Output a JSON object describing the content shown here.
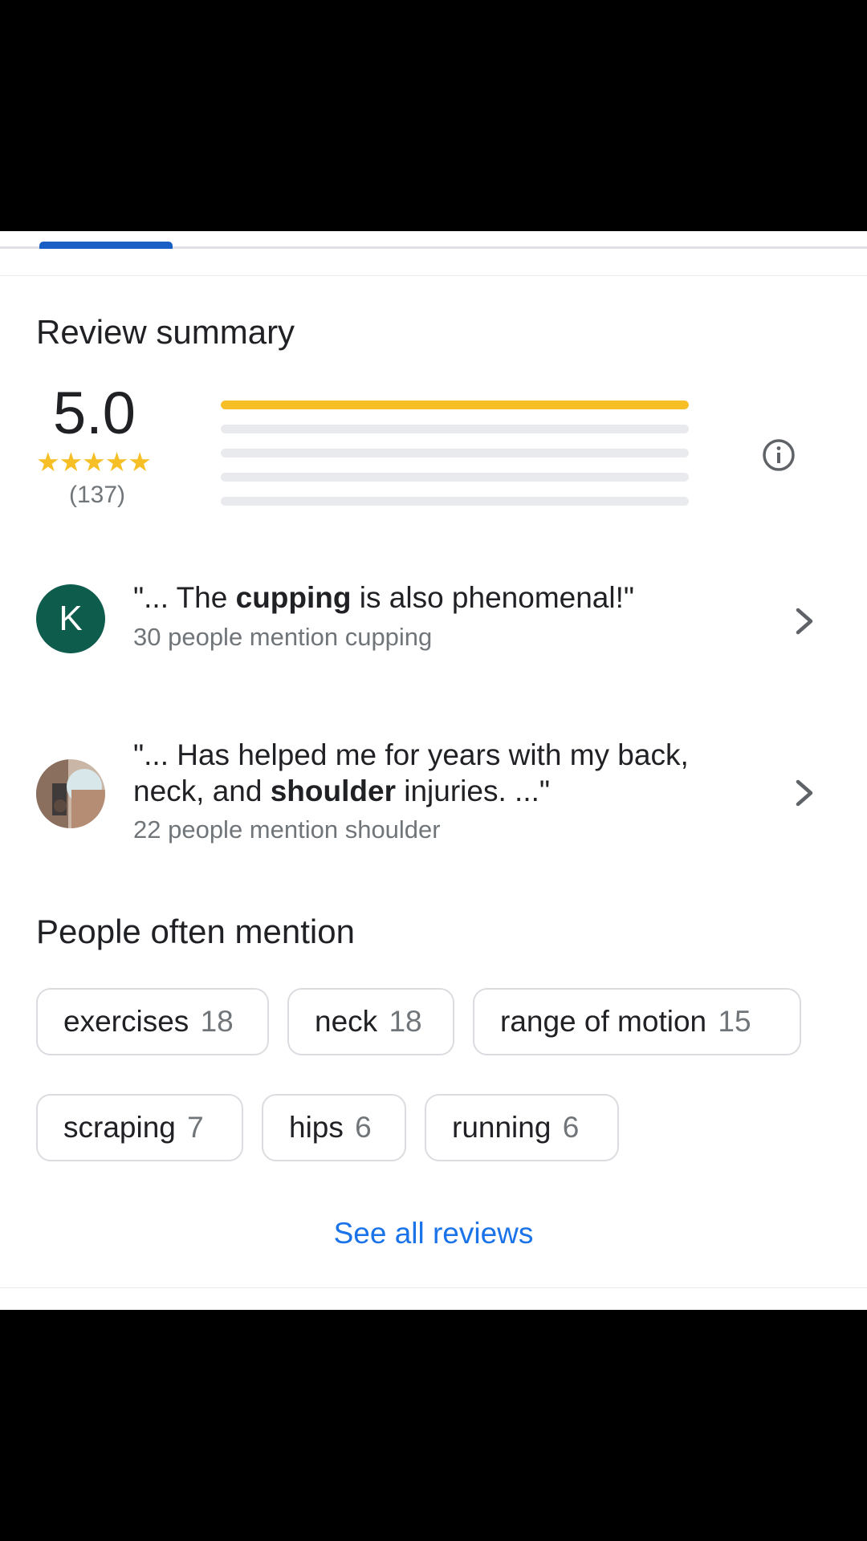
{
  "review_summary": {
    "title": "Review summary",
    "score": "5.0",
    "stars": "★★★★★",
    "count": "(137)",
    "rating_bars": [
      {
        "stars": 5,
        "fraction": 1.0
      },
      {
        "stars": 4,
        "fraction": 0.0
      },
      {
        "stars": 3,
        "fraction": 0.0
      },
      {
        "stars": 2,
        "fraction": 0.0
      },
      {
        "stars": 1,
        "fraction": 0.0
      }
    ],
    "info_icon": "info-icon"
  },
  "snippets": [
    {
      "avatar_letter": "K",
      "avatar_color": "#0d5c4c",
      "quote_pre": "\"... The ",
      "quote_bold": "cupping",
      "quote_post": " is also phenomenal!\"",
      "mention": "30 people mention cupping"
    },
    {
      "avatar": "user-photo",
      "quote_pre": "\"... Has helped me for years with my back, neck, and ",
      "quote_bold": "shoulder",
      "quote_post": " injuries. ...\"",
      "mention": "22 people mention shoulder"
    }
  ],
  "people_often_mention": {
    "title": "People often mention",
    "chips": [
      {
        "label": "exercises",
        "count": "18"
      },
      {
        "label": "neck",
        "count": "18"
      },
      {
        "label": "range of motion",
        "count": "15"
      },
      {
        "label": "scraping",
        "count": "7"
      },
      {
        "label": "hips",
        "count": "6"
      },
      {
        "label": "running",
        "count": "6"
      }
    ]
  },
  "see_all_label": "See all reviews",
  "colors": {
    "accent": "#1a73e8",
    "star": "#f6bf26",
    "tab_indicator": "#1a5fc6"
  }
}
